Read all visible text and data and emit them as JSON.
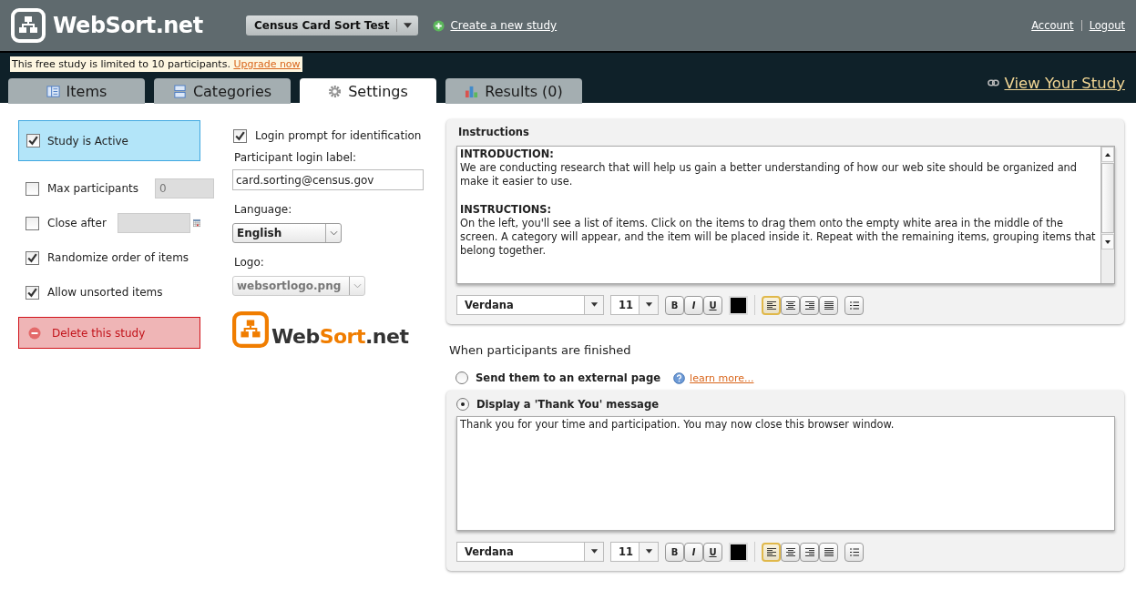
{
  "header": {
    "brand": "WebSort.net",
    "study_select": "Census Card Sort Test",
    "create_link": "Create a new study",
    "account_link": "Account",
    "logout_link": "Logout"
  },
  "notice": {
    "text": "This free study is limited to 10 participants.",
    "link": "Upgrade now"
  },
  "tabs": [
    {
      "label": "Items",
      "kind": "items",
      "selected": false
    },
    {
      "label": "Categories",
      "kind": "categories",
      "selected": false
    },
    {
      "label": "Settings",
      "kind": "settings",
      "selected": true
    },
    {
      "label": "Results (0)",
      "kind": "results",
      "selected": false
    }
  ],
  "view_link": "View Your Study",
  "left_options": [
    {
      "kind": "active",
      "label": "Study is Active",
      "checked": true
    },
    {
      "kind": "number",
      "label": "Max participants",
      "checked": false,
      "value": "0"
    },
    {
      "kind": "date",
      "label": "Close after",
      "checked": false
    },
    {
      "kind": "check",
      "label": "Randomize order of items",
      "checked": true
    },
    {
      "kind": "check",
      "label": "Allow unsorted items",
      "checked": true
    }
  ],
  "delete_button": "Delete this study",
  "login_prompt": {
    "label": "Login prompt for identification",
    "checked": true
  },
  "login_label": {
    "label": "Participant login label:",
    "value": "card.sorting@census.gov"
  },
  "language": {
    "label": "Language:",
    "value": "English"
  },
  "logo": {
    "label": "Logo:",
    "value": "websortlogo.png",
    "disabled": true,
    "text_parts": [
      "Web",
      "Sort",
      ".net"
    ]
  },
  "instructions": {
    "title": "Instructions",
    "paragraphs": [
      {
        "kind": "heading",
        "text": "INTRODUCTION:"
      },
      {
        "kind": "text",
        "text": "We are conducting research that will help us gain a better understanding of how our web site should be organized and make it easier to use."
      },
      {
        "kind": "heading",
        "text": "INSTRUCTIONS:"
      },
      {
        "kind": "text",
        "text": "On the left, you'll see a list of items. Click on the items to drag them onto the empty white area in the middle of the screen. A category will appear, and the item will be placed inside it. Repeat with the remaining items, grouping items that belong together."
      }
    ],
    "toolbar": {
      "font": "Verdana",
      "size": "11",
      "format_buttons": [
        "B",
        "I",
        "U"
      ],
      "align": [
        {
          "kind": "left",
          "selected": true
        },
        {
          "kind": "center",
          "selected": false
        },
        {
          "kind": "right",
          "selected": false
        },
        {
          "kind": "justify",
          "selected": false
        }
      ]
    }
  },
  "finish": {
    "heading": "When participants are finished",
    "options": [
      {
        "label": "Send them to an external page",
        "selected": false,
        "link": "learn more..."
      },
      {
        "label": "Display a 'Thank You' message",
        "selected": true,
        "message": "Thank you for your time and participation. You may now close this browser window."
      }
    ],
    "toolbar": {
      "font": "Verdana",
      "size": "11",
      "format_buttons": [
        "B",
        "I",
        "U"
      ],
      "align": [
        {
          "kind": "left",
          "selected": true
        },
        {
          "kind": "center",
          "selected": false
        },
        {
          "kind": "right",
          "selected": false
        },
        {
          "kind": "justify",
          "selected": false
        }
      ]
    }
  }
}
